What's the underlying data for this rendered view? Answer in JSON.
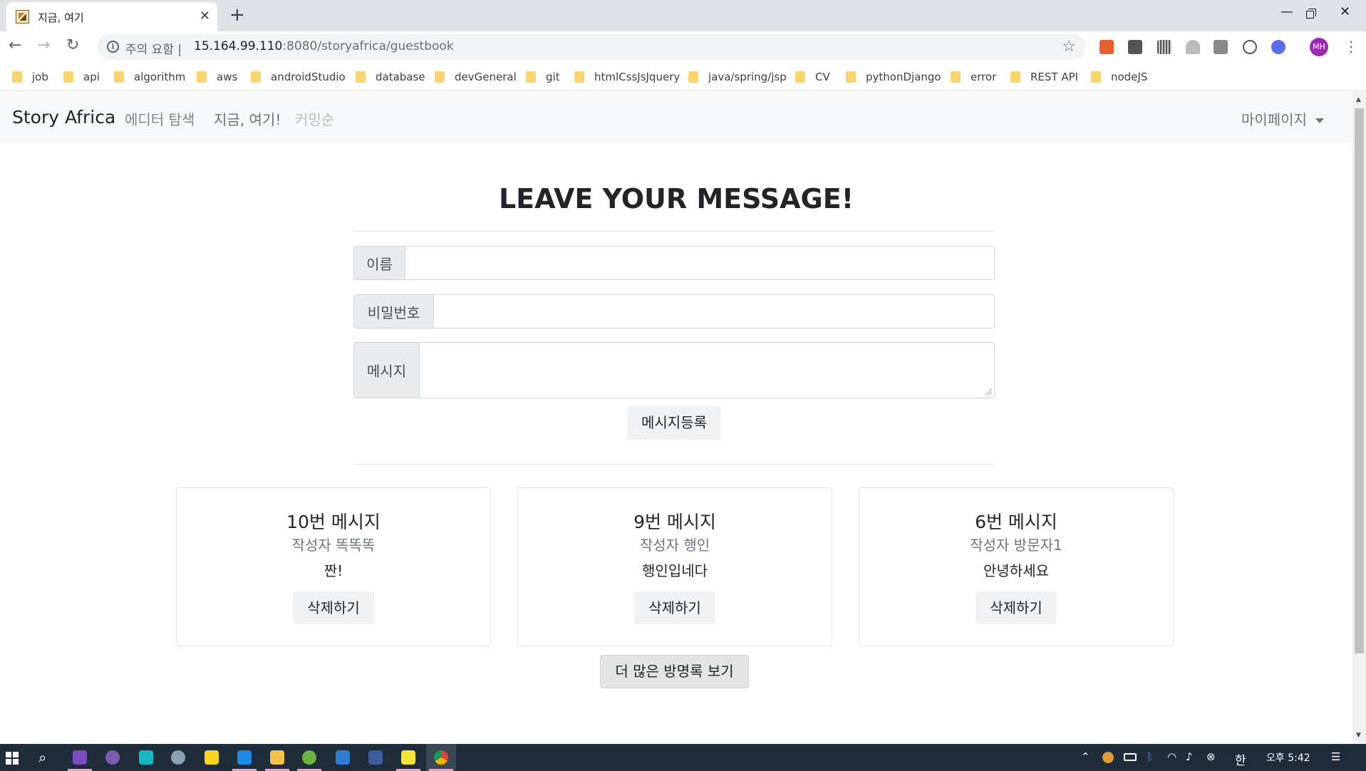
{
  "browser": {
    "tab_title": "지금, 여기",
    "url_warning": "주의 요함 |",
    "url_host": "15.164.99.110",
    "url_path": ":8080/storyafrica/guestbook",
    "profile_initials": "MH"
  },
  "bookmarks": [
    "job",
    "api",
    "algorithm",
    "aws",
    "androidStudio",
    "database",
    "devGeneral",
    "git",
    "htmlCssJsJquery",
    "java/spring/jsp",
    "CV",
    "pythonDjango",
    "error",
    "REST API",
    "nodeJS"
  ],
  "navbar": {
    "brand": "Story Africa",
    "links": [
      "에디터 탐색",
      "지금, 여기!",
      "커밍순"
    ],
    "mypage": "마이페이지"
  },
  "form": {
    "heading": "LEAVE YOUR MESSAGE!",
    "name_label": "이름",
    "name_value": "",
    "password_label": "비밀번호",
    "password_value": "",
    "message_label": "메시지",
    "message_value": "",
    "submit_label": "메시지등록"
  },
  "messages": [
    {
      "title": "10번 메시지",
      "author": "작성자 똑똑똑",
      "text": "짠!",
      "delete_label": "삭제하기"
    },
    {
      "title": "9번 메시지",
      "author": "작성자 행인",
      "text": "행인입네다",
      "delete_label": "삭제하기"
    },
    {
      "title": "6번 메시지",
      "author": "작성자 방문자1",
      "text": "안녕하세요",
      "delete_label": "삭제하기"
    }
  ],
  "more_label": "더 많은 방명록 보기",
  "taskbar": {
    "ime": "한",
    "clock": "오후 5:42"
  },
  "colors": {
    "navbar_bg": "#f8f9fa",
    "taskbar_bg": "#1f2d3a",
    "omnibox_bg": "#f1f3f4"
  }
}
